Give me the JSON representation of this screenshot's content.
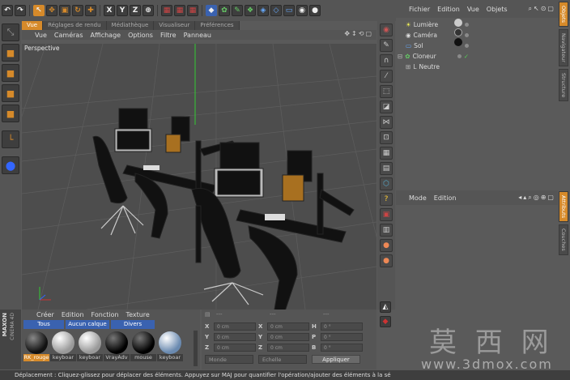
{
  "top_toolbar": {
    "axis_labels": [
      "X",
      "Y",
      "Z"
    ]
  },
  "viewport": {
    "menu": [
      "Vue",
      "Caméras",
      "Affichage",
      "Options",
      "Filtre",
      "Panneau"
    ],
    "tabs": [
      "Vue",
      "Réglages de rendu",
      "Médiathèque",
      "Visualiseur",
      "Préférences"
    ],
    "label": "Perspective"
  },
  "objects_panel": {
    "menu": [
      "Fichier",
      "Edition",
      "Vue",
      "Objets"
    ],
    "items": [
      {
        "name": "Lumière",
        "indent": 1
      },
      {
        "name": "Caméra",
        "indent": 1
      },
      {
        "name": "Sol",
        "indent": 1
      },
      {
        "name": "Cloneur",
        "indent": 0
      },
      {
        "name": "Neutre",
        "indent": 1
      }
    ],
    "side_tabs": [
      "Objets",
      "Navigateur",
      "Structure"
    ]
  },
  "attributes_panel": {
    "menu": [
      "Mode",
      "Edition"
    ],
    "side_tabs": [
      "Attributs",
      "Couches"
    ]
  },
  "materials_panel": {
    "menu": [
      "Créer",
      "Edition",
      "Fonction",
      "Texture"
    ],
    "filters": [
      "Tous",
      "Aucun calque",
      "Divers"
    ],
    "materials": [
      "RK_rouge",
      "keyboar",
      "keyboar",
      "VrayAdv",
      "mouse",
      "keyboar"
    ],
    "logo_top": "MAXON",
    "logo_bottom": "CINEMA 4D"
  },
  "coords_panel": {
    "header": [
      "---",
      "---",
      "---"
    ],
    "rows": [
      {
        "a": "X",
        "av": "0 cm",
        "b": "X",
        "bv": "0 cm",
        "c": "H",
        "cv": "0 °"
      },
      {
        "a": "Y",
        "av": "0 cm",
        "b": "Y",
        "bv": "0 cm",
        "c": "P",
        "cv": "0 °"
      },
      {
        "a": "Z",
        "av": "0 cm",
        "b": "Z",
        "bv": "0 cm",
        "c": "B",
        "cv": "0 °"
      }
    ],
    "mode_select": "Monde",
    "scale_select": "Echelle",
    "apply_button": "Appliquer"
  },
  "status_bar": {
    "text": "Déplacement : Cliquez-glissez pour déplacer des éléments. Appuyez sur MAJ pour quantifier l'opération/ajouter des éléments à la sé"
  },
  "watermark": {
    "chars": "莫 西 网",
    "url": "www.3dmox.com"
  },
  "colors": {
    "accent": "#d68a2a",
    "panel": "#5a5a5a",
    "viewport_bg": "#4d4d4d"
  }
}
